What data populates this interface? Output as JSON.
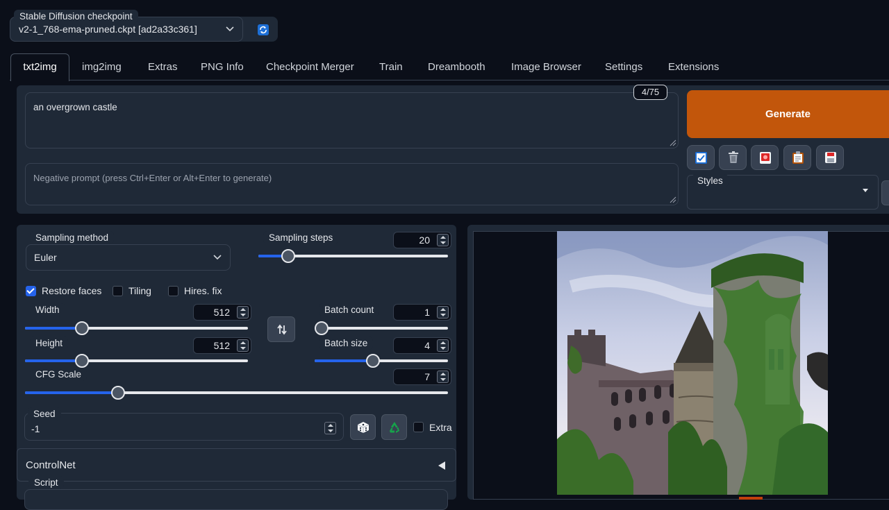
{
  "checkpoint": {
    "label": "Stable Diffusion checkpoint",
    "value": "v2-1_768-ema-pruned.ckpt [ad2a33c361]",
    "refresh_icon": "refresh-icon"
  },
  "tabs": [
    "txt2img",
    "img2img",
    "Extras",
    "PNG Info",
    "Checkpoint Merger",
    "Train",
    "Dreambooth",
    "Image Browser",
    "Settings",
    "Extensions"
  ],
  "active_tab": "txt2img",
  "prompt": {
    "value": "an overgrown castle",
    "token_count": "4/75",
    "negative_placeholder": "Negative prompt (press Ctrl+Enter or Alt+Enter to generate)"
  },
  "generate": {
    "label": "Generate",
    "color": "#c2560b"
  },
  "tools": [
    "checkbox-icon",
    "trash-icon",
    "card-icon",
    "clipboard-icon",
    "save-icon"
  ],
  "styles": {
    "label": "Styles",
    "value": ""
  },
  "params": {
    "sampling_method": {
      "label": "Sampling method",
      "value": "Euler"
    },
    "sampling_steps": {
      "label": "Sampling steps",
      "value": "20",
      "fraction": 0.13
    },
    "restore_faces": {
      "label": "Restore faces",
      "checked": true
    },
    "tiling": {
      "label": "Tiling",
      "checked": false
    },
    "hires_fix": {
      "label": "Hires. fix",
      "checked": false
    },
    "width": {
      "label": "Width",
      "value": "512",
      "fraction": 0.24
    },
    "height": {
      "label": "Height",
      "value": "512",
      "fraction": 0.24
    },
    "batch_count": {
      "label": "Batch count",
      "value": "1",
      "fraction": 0.0
    },
    "batch_size": {
      "label": "Batch size",
      "value": "4",
      "fraction": 0.43
    },
    "cfg_scale": {
      "label": "CFG Scale",
      "value": "7",
      "fraction": 0.21
    },
    "seed": {
      "label": "Seed",
      "value": "-1"
    },
    "extra": {
      "label": "Extra",
      "checked": false
    }
  },
  "controlnet": {
    "label": "ControlNet"
  },
  "script": {
    "label": "Script"
  },
  "accent_color": "#2563eb"
}
